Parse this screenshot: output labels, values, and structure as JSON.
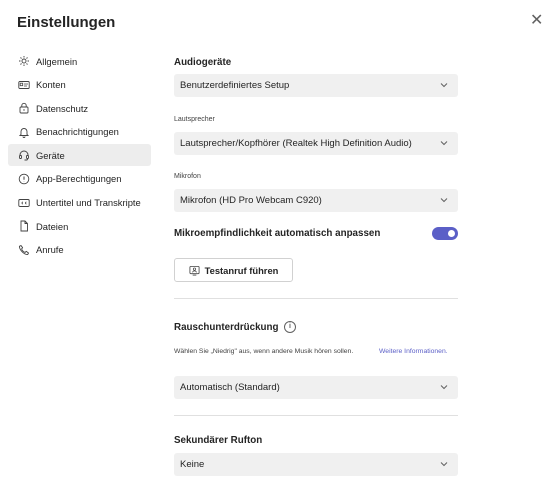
{
  "header": {
    "title": "Einstellungen",
    "close_icon": "close-icon"
  },
  "sidebar": {
    "items": [
      {
        "label": "Allgemein",
        "icon": "gear-icon",
        "active": false
      },
      {
        "label": "Konten",
        "icon": "id-card-icon",
        "active": false
      },
      {
        "label": "Datenschutz",
        "icon": "lock-icon",
        "active": false
      },
      {
        "label": "Benachrichtigungen",
        "icon": "bell-icon",
        "active": false
      },
      {
        "label": "Geräte",
        "icon": "headset-icon",
        "active": true
      },
      {
        "label": "App-Berechtigungen",
        "icon": "shield-icon",
        "active": false
      },
      {
        "label": "Untertitel und Transkripte",
        "icon": "cc-icon",
        "active": false
      },
      {
        "label": "Dateien",
        "icon": "file-icon",
        "active": false
      },
      {
        "label": "Anrufe",
        "icon": "phone-icon",
        "active": false
      }
    ]
  },
  "audio": {
    "heading": "Audiogeräte",
    "device_value": "Benutzerdefiniertes Setup",
    "speaker_label": "Lautsprecher",
    "speaker_value": "Lautsprecher/Kopfhörer (Realtek High Definition Audio)",
    "mic_label": "Mikrofon",
    "mic_value": "Mikrofon (HD Pro Webcam C920)",
    "auto_sensitivity_label": "Mikroempfindlichkeit automatisch anpassen",
    "auto_sensitivity_on": true,
    "test_call_label": "Testanruf führen"
  },
  "noise": {
    "heading": "Rauschunterdrückung",
    "description": "Wählen Sie „Niedrig\" aus, wenn andere Musik hören sollen.",
    "link_label": "Weitere Informationen.",
    "value": "Automatisch (Standard)"
  },
  "ringtone": {
    "heading": "Sekundärer Rufton",
    "value": "Keine"
  },
  "colors": {
    "accent": "#5b5fc7",
    "active_bg": "#ededed",
    "select_bg": "#f0f0f0"
  }
}
